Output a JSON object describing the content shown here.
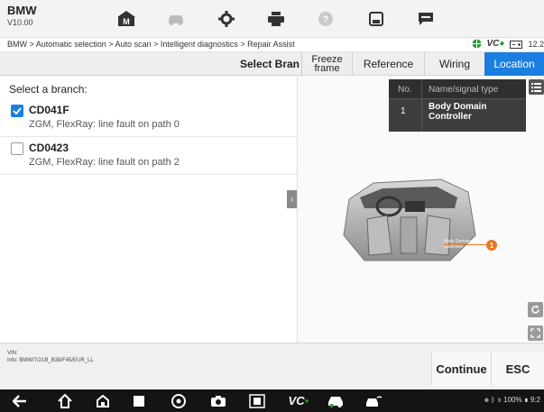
{
  "app": {
    "name": "BMW",
    "version": "V10.00"
  },
  "breadcrumb": "BMW > Automatic selection > Auto scan > Intelligent diagnostics > Repair Assist",
  "header_right": {
    "vci_text": "VC",
    "battery_text": "12.2"
  },
  "tabs": [
    {
      "label": "Select Bran",
      "active": false
    },
    {
      "label_line1": "Freeze",
      "label_line2": "frame",
      "active": false
    },
    {
      "label": "Reference",
      "active": false
    },
    {
      "label": "Wiring",
      "active": false
    },
    {
      "label": "Location",
      "active": true
    }
  ],
  "branch_panel": {
    "title": "Select a branch:",
    "items": [
      {
        "code": "CD041F",
        "desc": "ZGM, FlexRay: line fault on path 0",
        "checked": true
      },
      {
        "code": "CD0423",
        "desc": "ZGM, FlexRay: line fault on path 2",
        "checked": false
      }
    ]
  },
  "signal_table": {
    "col_no": "No.",
    "col_name": "Name/signal type",
    "rows": [
      {
        "no": "1",
        "name": "Body Domain Controller"
      }
    ]
  },
  "car_callout": {
    "label_line1": "Body Domain",
    "label_line2": "Controller",
    "marker": "1"
  },
  "footer": {
    "vin_label": "VIN:",
    "info": "Info: BMW/7/21B_B38/F45/EUR_LL",
    "continue_label": "Continue",
    "esc_label": "ESC"
  },
  "nav": {
    "vci_label": "VC",
    "status_text": "100%",
    "time": "9:2"
  },
  "colors": {
    "accent": "#1a7fe0",
    "marker": "#e87722",
    "navbar": "#141414"
  }
}
